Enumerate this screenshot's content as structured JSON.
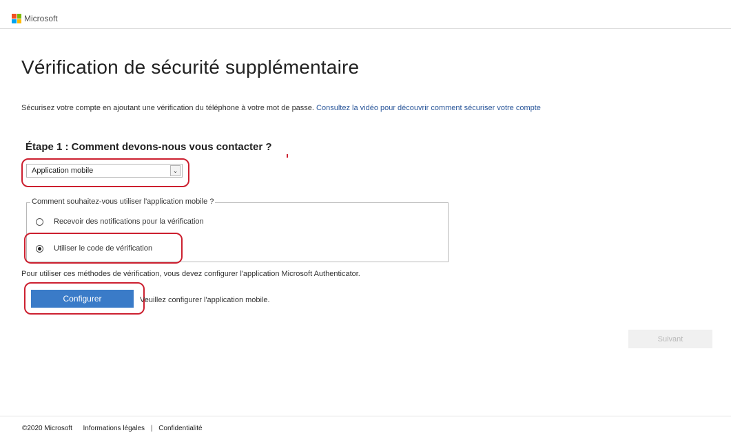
{
  "header": {
    "brand": "Microsoft",
    "logo_colors": [
      "#f25022",
      "#7fba00",
      "#00a4ef",
      "#ffb900"
    ]
  },
  "main": {
    "title": "Vérification de sécurité supplémentaire",
    "intro_text": "Sécurisez votre compte en ajoutant une vérification du téléphone à votre mot de passe.",
    "intro_link": "Consultez la vidéo pour découvrir comment sécuriser votre compte",
    "step_title": "Étape 1 : Comment devons-nous vous contacter ?",
    "contact_method": {
      "selected": "Application mobile"
    },
    "usage": {
      "legend": "Comment souhaitez-vous utiliser l'application mobile ?",
      "options": [
        {
          "label": "Recevoir des notifications pour la vérification",
          "checked": false
        },
        {
          "label": "Utiliser le code de vérification",
          "checked": true
        }
      ]
    },
    "note": "Pour utiliser ces méthodes de vérification, vous devez configurer l'application Microsoft Authenticator.",
    "configure_button": "Configurer",
    "configure_message": "Veuillez configurer l'application mobile.",
    "next_button": "Suivant"
  },
  "footer": {
    "copyright": "©2020 Microsoft",
    "legal_link": "Informations légales",
    "separator": "|",
    "privacy_link": "Confidentialité"
  },
  "colors": {
    "primary_button": "#3a7bc8",
    "link": "#2b579a",
    "annotation": "#cc1f2f"
  }
}
